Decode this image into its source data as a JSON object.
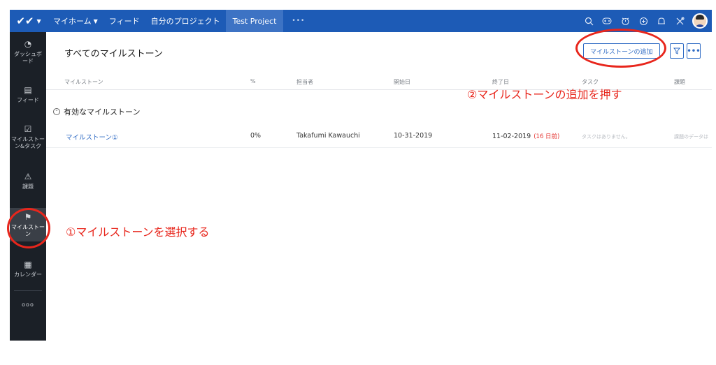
{
  "topbar": {
    "nav": [
      "マイホーム",
      "フィード",
      "自分のプロジェクト"
    ],
    "active_project": "Test Project",
    "more": "•••",
    "icons": [
      "search-icon",
      "gamepad-icon",
      "timer-icon",
      "plus-circle-icon",
      "bell-icon",
      "tools-icon"
    ]
  },
  "sidebar": {
    "items": [
      {
        "icon": "dashboard-icon",
        "label": "ダッシュボード"
      },
      {
        "icon": "feed-icon",
        "label": "フィード"
      },
      {
        "icon": "milestone-task-icon",
        "label": "マイルストーン&タスク"
      },
      {
        "icon": "warning-icon",
        "label": "課題"
      },
      {
        "icon": "signpost-icon",
        "label": "マイルストーン"
      },
      {
        "icon": "calendar-icon",
        "label": "カレンダー"
      }
    ],
    "more": "ooo"
  },
  "page": {
    "title": "すべてのマイルストーン",
    "add_button": "マイルストーンの追加",
    "filter_icon": "filter-icon",
    "more_button": "•••"
  },
  "table": {
    "headers": [
      "マイルストーン",
      "%",
      "担当者",
      "開始日",
      "終了日",
      "タスク",
      "課題"
    ],
    "group": "有効なマイルストーン",
    "row": {
      "name": "マイルストーン①",
      "percent": "0%",
      "owner": "Takafumi Kawauchi",
      "start": "10-31-2019",
      "end": "11-02-2019",
      "late": "(16 日前)",
      "tasks": "タスクはありません。",
      "issues": "課題のデータは"
    }
  },
  "annotations": {
    "step2": "②マイルストーンの追加を押す",
    "step1": "①マイルストーンを選択する",
    "color": "#e8261c"
  },
  "colors": {
    "topbar": "#1d5bb6",
    "sidebar": "#1b2027",
    "link": "#2f6bc4",
    "late": "#e53935"
  }
}
